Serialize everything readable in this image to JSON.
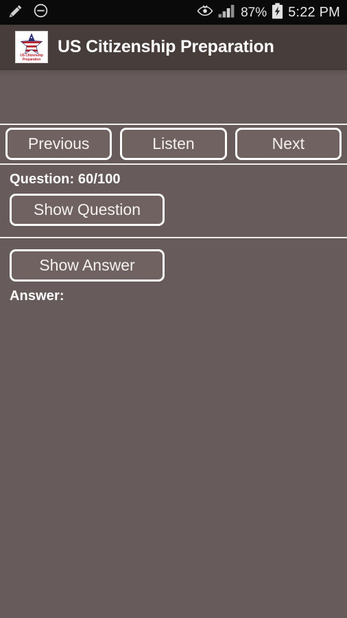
{
  "status_bar": {
    "left_icons": [
      {
        "name": "pen-icon",
        "glyph": "pen"
      },
      {
        "name": "do-not-disturb-icon",
        "glyph": "minus-circle"
      }
    ],
    "right_icons": [
      {
        "name": "eye-icon",
        "glyph": "eye"
      },
      {
        "name": "signal-bars-icon",
        "glyph": "signal"
      },
      {
        "name": "battery-charging-icon",
        "glyph": "battery-bolt"
      }
    ],
    "battery_percent": "87%",
    "clock": "5:22 PM"
  },
  "app_bar": {
    "title": "US Citizenship Preparation",
    "icon_name": "app-logo-icon",
    "icon_caption_line1": "US Citizenship",
    "icon_caption_line2": "Preparation"
  },
  "nav": {
    "previous_label": "Previous",
    "listen_label": "Listen",
    "next_label": "Next"
  },
  "question_section": {
    "counter_label": "Question:  60/100",
    "show_question_label": "Show Question"
  },
  "answer_section": {
    "show_answer_label": "Show Answer",
    "answer_label": "Answer:",
    "answer_text": ""
  },
  "colors": {
    "status_bar_bg": "#0a0a0a",
    "app_bar_bg": "#473e3b",
    "page_bg": "#675b5b",
    "button_bg": "#6f6261",
    "border": "#ffffff",
    "text": "#ffffff",
    "flag_blue": "#2b2f77",
    "flag_red": "#b4232c"
  }
}
